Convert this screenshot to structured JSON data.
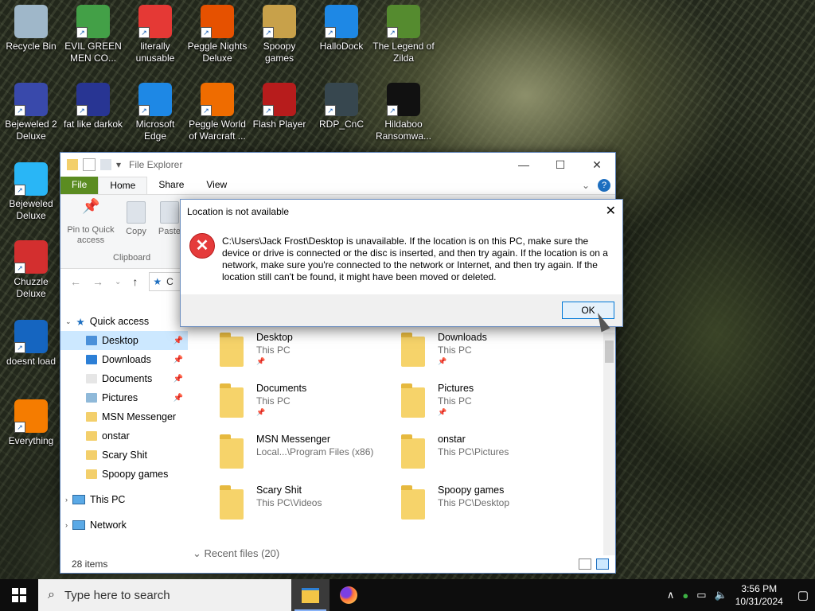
{
  "desktop_icons": [
    {
      "label": "Recycle Bin",
      "icon": "recycle-bin-icon",
      "color": "#9fb7c9"
    },
    {
      "label": "EVIL GREEN MEN CO...",
      "icon": "green-men-icon",
      "color": "#43a047"
    },
    {
      "label": "literally unusable",
      "icon": "chrome-icon",
      "color": "#e53935"
    },
    {
      "label": "Peggle Nights Deluxe",
      "icon": "peggle-icon",
      "color": "#e65100"
    },
    {
      "label": "Spoopy games",
      "icon": "folder-icon",
      "color": "#c8a14a"
    },
    {
      "label": "HalloDock",
      "icon": "shield-icon",
      "color": "#1e88e5"
    },
    {
      "label": "The Legend of Zilda",
      "icon": "zilda-icon",
      "color": "#558b2f"
    },
    {
      "label": "Bejeweled 2 Deluxe",
      "icon": "bejeweled-icon",
      "color": "#3949ab"
    },
    {
      "label": "fat like darkok",
      "icon": "mpl-icon",
      "color": "#283593"
    },
    {
      "label": "Microsoft Edge",
      "icon": "edge-icon",
      "color": "#1e88e5"
    },
    {
      "label": "Peggle World of Warcraft ...",
      "icon": "peggle-icon",
      "color": "#ef6c00"
    },
    {
      "label": "Flash Player",
      "icon": "flash-icon",
      "color": "#b71c1c"
    },
    {
      "label": "RDP_CnC",
      "icon": "rdp-icon",
      "color": "#37474f"
    },
    {
      "label": "Hildaboo Ransomwa...",
      "icon": "yashma-icon",
      "color": "#111111"
    },
    {
      "label": "Bejeweled Deluxe",
      "icon": "diamond-icon",
      "color": "#29b6f6"
    },
    {
      "label": "Chuzzle Deluxe",
      "icon": "chuzzle-icon",
      "color": "#d32f2f"
    },
    {
      "label": "doesnt load",
      "icon": "thunderbird-icon",
      "color": "#1565c0"
    },
    {
      "label": "Everything",
      "icon": "everything-icon",
      "color": "#f57c00"
    }
  ],
  "explorer": {
    "title": "File Explorer",
    "controls": {
      "minimize": "—",
      "maximize": "☐",
      "close": "✕"
    },
    "tabs": [
      "File",
      "Home",
      "Share",
      "View"
    ],
    "ribbon": {
      "pin_label": "Pin to Quick access",
      "copy_label": "Copy",
      "paste_label": "Paste",
      "group_label": "Clipboard"
    },
    "address_prefix": "C",
    "nav": {
      "quick_access": "Quick access",
      "items": [
        "Desktop",
        "Downloads",
        "Documents",
        "Pictures",
        "MSN Messenger",
        "onstar",
        "Scary Shit",
        "Spoopy games"
      ],
      "this_pc": "This PC",
      "network": "Network"
    },
    "content_items": [
      {
        "name": "Desktop",
        "sub": "This PC",
        "pin": "📌"
      },
      {
        "name": "Downloads",
        "sub": "This PC",
        "pin": "📌"
      },
      {
        "name": "Documents",
        "sub": "This PC",
        "pin": "📌"
      },
      {
        "name": "Pictures",
        "sub": "This PC",
        "pin": "📌"
      },
      {
        "name": "MSN Messenger",
        "sub": "Local...\\Program Files (x86)",
        "pin": ""
      },
      {
        "name": "onstar",
        "sub": "This PC\\Pictures",
        "pin": ""
      },
      {
        "name": "Scary Shit",
        "sub": "This PC\\Videos",
        "pin": ""
      },
      {
        "name": "Spoopy games",
        "sub": "This PC\\Desktop",
        "pin": ""
      }
    ],
    "recent_files": "Recent files (20)",
    "status": "28 items"
  },
  "dialog": {
    "title": "Location is not available",
    "message": "C:\\Users\\Jack Frost\\Desktop is unavailable. If the location is on this PC, make sure the device or drive is connected or the disc is inserted, and then try again. If the location is on a network, make sure you're connected to the network or Internet, and then try again. If the location still can't be found, it might have been moved or deleted.",
    "ok_label": "OK",
    "close_glyph": "✕"
  },
  "taskbar": {
    "search_placeholder": "Type here to search",
    "time": "3:56 PM",
    "date": "10/31/2024"
  }
}
